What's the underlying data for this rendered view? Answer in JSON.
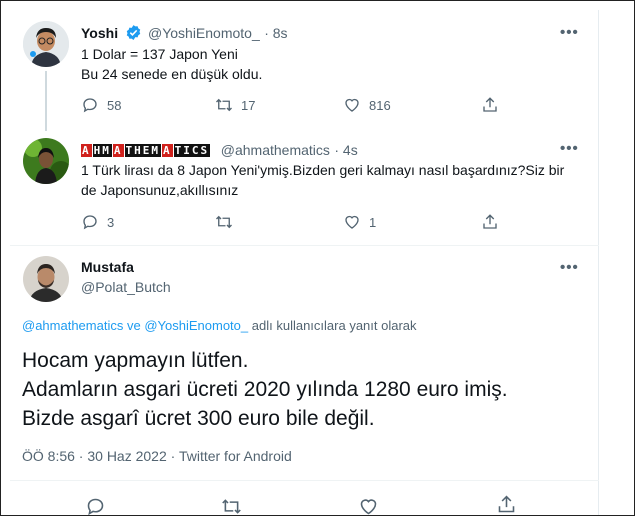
{
  "tweets": [
    {
      "name": "Yoshi",
      "handle": "@YoshiEnomoto_",
      "time": "· 8s",
      "text": "1 Dolar = 137 Japon Yeni\nBu 24 senede en düşük oldu.",
      "replies": "58",
      "retweets": "17",
      "likes": "816"
    },
    {
      "name": "AHMATHEMATICS",
      "name_segments": [
        {
          "text": "A",
          "style": "red"
        },
        {
          "text": "HM",
          "style": "black"
        },
        {
          "text": "A",
          "style": "red"
        },
        {
          "text": "THEM",
          "style": "black"
        },
        {
          "text": "A",
          "style": "red"
        },
        {
          "text": "TICS",
          "style": "black"
        }
      ],
      "handle": "@ahmathematics",
      "time": "· 4s",
      "text": "1 Türk lirası da 8 Japon Yeni'ymiş.Bizden geri kalmayı nasıl başardınız?Siz bir\nde Japonsunuz,akıllısınız",
      "replies": "3",
      "retweets": "",
      "likes": "1"
    }
  ],
  "main": {
    "name": "Mustafa",
    "handle": "@Polat_Butch",
    "reply_handle_1": "@ahmathematics",
    "reply_ve": "ve",
    "reply_handle_2": "@YoshiEnomoto_",
    "reply_suffix": "adlı kullanıcılara yanıt olarak",
    "text": "Hocam yapmayın lütfen.\nAdamların asgari ücreti 2020 yılında 1280 euro imiş.\nBizde asgarî ücret 300 euro bile değil.",
    "meta": "ÖÖ 8:56 · 30 Haz 2022 · Twitter for Android"
  },
  "more_label": "•••",
  "colors": {
    "accent": "#1d9bf0",
    "muted": "#536471",
    "text": "#0f1419",
    "verified": "#1d9bf0"
  },
  "icons": [
    "reply-icon",
    "retweet-icon",
    "like-icon",
    "share-icon",
    "verified-icon",
    "more-icon"
  ]
}
